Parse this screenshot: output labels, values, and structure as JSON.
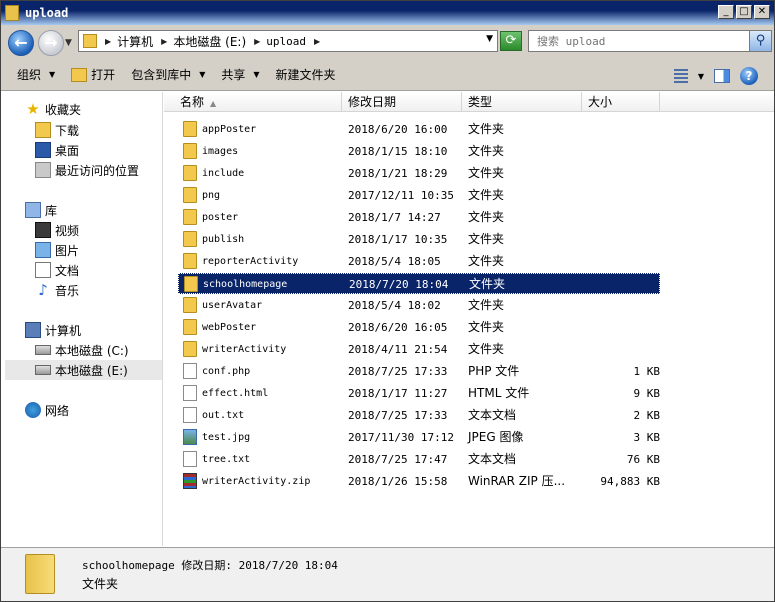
{
  "window": {
    "title": "upload",
    "controls": [
      "_",
      "□",
      "✕"
    ]
  },
  "address": {
    "crumbs": [
      "计算机",
      "本地磁盘 (E:)",
      "upload"
    ],
    "search_placeholder": "搜索 upload"
  },
  "toolbar": {
    "organize": "组织",
    "open": "打开",
    "include_in_library": "包含到库中",
    "share": "共享",
    "new_folder": "新建文件夹"
  },
  "sidebar": {
    "favorites": "收藏夹",
    "downloads": "下载",
    "desktop": "桌面",
    "recent": "最近访问的位置",
    "libraries": "库",
    "videos": "视频",
    "pictures": "图片",
    "documents": "文档",
    "music": "音乐",
    "computer": "计算机",
    "drive_c": "本地磁盘 (C:)",
    "drive_e": "本地磁盘 (E:)",
    "network": "网络"
  },
  "columns": {
    "name": "名称",
    "date": "修改日期",
    "type": "类型",
    "size": "大小"
  },
  "files": [
    {
      "name": "appPoster",
      "date": "2018/6/20 16:00",
      "type": "文件夹",
      "size": "",
      "kind": "folder"
    },
    {
      "name": "images",
      "date": "2018/1/15 18:10",
      "type": "文件夹",
      "size": "",
      "kind": "folder"
    },
    {
      "name": "include",
      "date": "2018/1/21 18:29",
      "type": "文件夹",
      "size": "",
      "kind": "folder"
    },
    {
      "name": "png",
      "date": "2017/12/11 10:35",
      "type": "文件夹",
      "size": "",
      "kind": "folder"
    },
    {
      "name": "poster",
      "date": "2018/1/7 14:27",
      "type": "文件夹",
      "size": "",
      "kind": "folder"
    },
    {
      "name": "publish",
      "date": "2018/1/17 10:35",
      "type": "文件夹",
      "size": "",
      "kind": "folder"
    },
    {
      "name": "reporterActivity",
      "date": "2018/5/4 18:05",
      "type": "文件夹",
      "size": "",
      "kind": "folder"
    },
    {
      "name": "schoolhomepage",
      "date": "2018/7/20 18:04",
      "type": "文件夹",
      "size": "",
      "kind": "folder"
    },
    {
      "name": "userAvatar",
      "date": "2018/5/4 18:02",
      "type": "文件夹",
      "size": "",
      "kind": "folder"
    },
    {
      "name": "webPoster",
      "date": "2018/6/20 16:05",
      "type": "文件夹",
      "size": "",
      "kind": "folder"
    },
    {
      "name": "writerActivity",
      "date": "2018/4/11 21:54",
      "type": "文件夹",
      "size": "",
      "kind": "folder"
    },
    {
      "name": "conf.php",
      "date": "2018/7/25 17:33",
      "type": "PHP 文件",
      "size": "1 KB",
      "kind": "file"
    },
    {
      "name": "effect.html",
      "date": "2018/1/17 11:27",
      "type": "HTML 文件",
      "size": "9 KB",
      "kind": "file"
    },
    {
      "name": "out.txt",
      "date": "2018/7/25 17:33",
      "type": "文本文档",
      "size": "2 KB",
      "kind": "file"
    },
    {
      "name": "test.jpg",
      "date": "2017/11/30 17:12",
      "type": "JPEG 图像",
      "size": "3 KB",
      "kind": "img"
    },
    {
      "name": "tree.txt",
      "date": "2018/7/25 17:47",
      "type": "文本文档",
      "size": "76 KB",
      "kind": "file"
    },
    {
      "name": "writerActivity.zip",
      "date": "2018/1/26 15:58",
      "type": "WinRAR ZIP 压...",
      "size": "94,883 KB",
      "kind": "zip"
    }
  ],
  "selected_index": 7,
  "details": {
    "name_line": "schoolhomepage 修改日期: 2018/7/20 18:04",
    "type": "文件夹"
  }
}
